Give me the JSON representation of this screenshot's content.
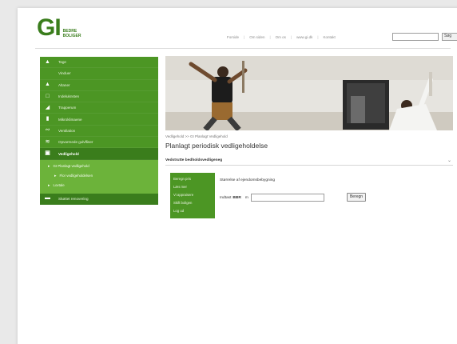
{
  "logo": {
    "mark": "GI",
    "line1": "BEDRE",
    "line2": "BOLIGER"
  },
  "topnav": {
    "items": [
      "Forside",
      "Om siden",
      "Om os",
      "www.gi.dk",
      "Kontakt"
    ],
    "search_placeholder": "",
    "search_button": "Søg"
  },
  "sidebar": {
    "items": [
      {
        "label": "Tage",
        "icon": "roof-icon"
      },
      {
        "label": "Vinduer",
        "icon": "window-icon"
      },
      {
        "label": "Altaner",
        "icon": "balcony-icon"
      },
      {
        "label": "Indeluknsten",
        "icon": "door-icon"
      },
      {
        "label": "Trapperum",
        "icon": "stairs-icon"
      },
      {
        "label": "Mikroklimaene",
        "icon": "building-icon"
      },
      {
        "label": "Ventilation",
        "icon": "ventilation-icon"
      },
      {
        "label": "Opvarmede gulvfliser",
        "icon": "heating-icon"
      }
    ],
    "active": {
      "label": "Vedligehold",
      "icon": "tools-icon"
    },
    "sub_items": [
      {
        "label": "GI Planlagt vedligehold",
        "level": 1
      },
      {
        "label": "Flor vedligeholdelsen",
        "level": 2
      },
      {
        "label": "Lovtale",
        "level": 1
      }
    ],
    "last": {
      "label": "Skøttet renovering",
      "icon": "renovation-icon"
    }
  },
  "main": {
    "breadcrumb": "Vedligehold >> GI Planlagt Vedligehold",
    "title": "Planlagt periodisk vedligeholdelse",
    "section": "Vedstrutte bedholdsvedligeneg",
    "inner_nav": [
      "Beregn pris",
      "Læs mer",
      "Vi appraisere",
      "Skift boligen",
      "Log ud"
    ],
    "form": {
      "label": "Størrelse af ejendomsbebygning",
      "row_label": "Indtast",
      "unit": "m",
      "unit_bold": "BBR",
      "input_value": "",
      "button": "Beregn"
    }
  }
}
